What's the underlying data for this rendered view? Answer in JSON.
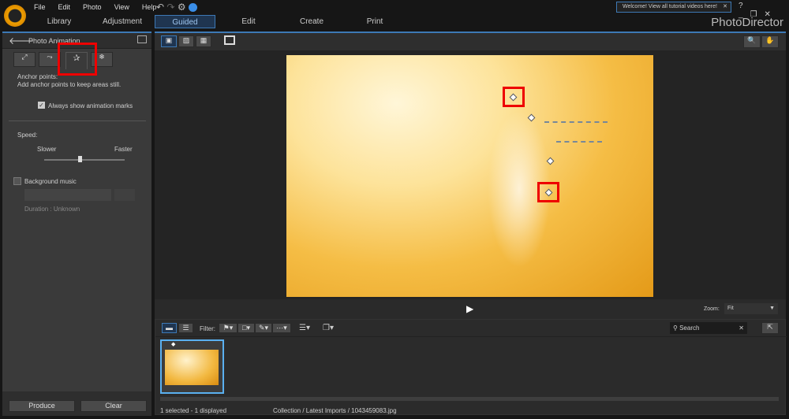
{
  "menu": [
    "File",
    "Edit",
    "Photo",
    "View",
    "Help"
  ],
  "tabs": [
    "Library",
    "Adjustment",
    "Guided",
    "Edit",
    "Create",
    "Print"
  ],
  "active_tab": "Guided",
  "tooltip": "Welcome! View all tutorial videos here!",
  "brand": "PhotoDirector",
  "panel": {
    "title": "Photo Animation",
    "subtabs": [
      "motion-arrow-icon",
      "motion-path-icon",
      "anchor-pin-icon",
      "freeze-icon"
    ],
    "heading": "Anchor points:",
    "description": "Add anchor points to keep areas still.",
    "show_marks_label": "Always show animation marks",
    "show_marks_checked": true,
    "speed_label": "Speed:",
    "slower": "Slower",
    "faster": "Faster",
    "speed_value": 0.45,
    "bg_music_label": "Background music",
    "bg_music_checked": false,
    "duration": "Duration : Unknown",
    "produce": "Produce",
    "clear": "Clear"
  },
  "viewer": {
    "zoom_label": "Zoom:",
    "zoom_value": "Fit"
  },
  "browser": {
    "filter_label": "Filter:",
    "search_placeholder": "Search"
  },
  "status": {
    "selection": "1 selected - 1 displayed",
    "path": "Collection / Latest Imports / 1043459083.jpg"
  },
  "colors": {
    "accent": "#3d79b5",
    "highlight": "#e00000",
    "thumb_border": "#5ab0f0"
  }
}
